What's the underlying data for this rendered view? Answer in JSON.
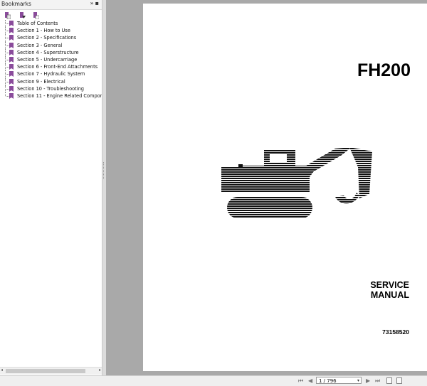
{
  "panel": {
    "title": "Bookmarks",
    "header_buttons": "»▪",
    "tool_icons": [
      "bookmark-options-icon",
      "expand-bookmark-icon",
      "new-bookmark-icon"
    ],
    "items": [
      {
        "label": "Table of Contents"
      },
      {
        "label": "Section 1 - How to Use"
      },
      {
        "label": "Section 2 - Specifications"
      },
      {
        "label": "Section 3 - General"
      },
      {
        "label": "Section 4 - Superstructure"
      },
      {
        "label": "Section 5 - Undercarriage"
      },
      {
        "label": "Section 6 - Front-End Attachments"
      },
      {
        "label": "Section 7 - Hydraulic System"
      },
      {
        "label": "Section 9 - Electrical"
      },
      {
        "label": "Section 10 - Troubleshooting"
      },
      {
        "label": "Section 11 - Engine Related Compone"
      }
    ]
  },
  "document": {
    "title": "FH200",
    "subtitle_line1": "SERVICE",
    "subtitle_line2": "MANUAL",
    "part_number": "73158520"
  },
  "navigation": {
    "page_field": "1 / 796"
  },
  "colors": {
    "viewer_background": "#a9a9a9",
    "bookmark_icon": "#8a4b9b",
    "page_background": "#ffffff"
  }
}
